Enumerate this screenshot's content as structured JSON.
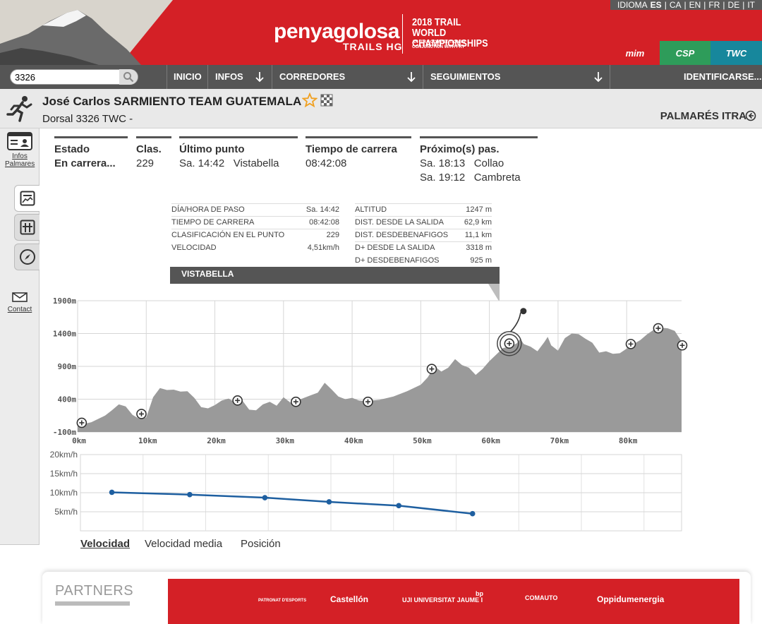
{
  "header": {
    "logo_main": "penyagolosa",
    "logo_sub": "TRAILS",
    "logo_sub_mark": "HG",
    "champ_title": "2018 TRAIL WORLD CHAMPIONSHIPS",
    "champ_sub": "AN ITRA COMPETITION IN CONJUNCTION WITH FRT",
    "language_label": "IDIOMA",
    "languages": [
      "ES",
      "CA",
      "EN",
      "FR",
      "DE",
      "IT"
    ],
    "active_language": "ES",
    "badges": [
      "mim",
      "CSP",
      "TWC"
    ]
  },
  "nav": {
    "search_value": "3326",
    "items": [
      "INICIO",
      "INFOS",
      "CORREDORES",
      "SEGUIMIENTOS",
      "IDENTIFICARSE..."
    ]
  },
  "runner": {
    "name": "José Carlos SARMIENTO",
    "team": "TEAM GUATEMALA",
    "dorsal": "Dorsal 3326   TWC -",
    "palmares": "PALMARÉS ITRA"
  },
  "sidebar": {
    "infos_label": "Infos",
    "palmares_label": "Palmares",
    "contact_label": "Contact"
  },
  "stats": {
    "estado_label": "Estado",
    "estado_value": "En carrera...",
    "clas_label": "Clas.",
    "clas_value": "229",
    "ultimo_label": "Último punto",
    "ultimo_value": "Sa. 14:42   Vistabella",
    "tiempo_label": "Tiempo de carrera",
    "tiempo_value": "08:42:08",
    "proximo_label": "Próximo(s) pas.",
    "proximo_values": [
      "Sa. 18:13   Collao",
      "Sa. 19:12   Cambreta"
    ]
  },
  "tooltip": {
    "left": [
      {
        "label": "DÍA/HORA DE PASO",
        "value": "Sa. 14:42"
      },
      {
        "label": "TIEMPO DE CARRERA",
        "value": "08:42:08"
      },
      {
        "label": "CLASIFICACIÓN EN EL PUNTO",
        "value": "229"
      },
      {
        "label": "VELOCIDAD",
        "value": "4,51km/h"
      }
    ],
    "right": [
      {
        "label": "ALTITUD",
        "value": "1247 m"
      },
      {
        "label": "DIST. DESDE LA SALIDA",
        "value": "62,9 km"
      },
      {
        "label": "DIST. DESDEBENAFIGOS",
        "value": "11,1 km"
      },
      {
        "label": "D+ DESDE LA SALIDA",
        "value": "3318 m"
      },
      {
        "label": "D+ DESDEBENAFIGOS",
        "value": "925 m"
      }
    ],
    "point_name": "VISTABELLA"
  },
  "chart_data": [
    {
      "type": "area",
      "ylim": [
        -100,
        1900
      ],
      "xlim": [
        0,
        88
      ],
      "y_ticks": [
        {
          "value": 1900,
          "label": "1900m"
        },
        {
          "value": 1400,
          "label": "1400m"
        },
        {
          "value": 900,
          "label": "900m"
        },
        {
          "value": 400,
          "label": "400m"
        },
        {
          "value": -100,
          "label": "-100m"
        }
      ],
      "x_ticks": [
        {
          "value": 0,
          "label": "0km"
        },
        {
          "value": 10,
          "label": "10km"
        },
        {
          "value": 20,
          "label": "20km"
        },
        {
          "value": 30,
          "label": "30km"
        },
        {
          "value": 40,
          "label": "40km"
        },
        {
          "value": 50,
          "label": "50km"
        },
        {
          "value": 60,
          "label": "60km"
        },
        {
          "value": 70,
          "label": "70km"
        },
        {
          "value": 80,
          "label": "80km"
        }
      ],
      "profile": [
        [
          0,
          0
        ],
        [
          2,
          50
        ],
        [
          4,
          150
        ],
        [
          5,
          230
        ],
        [
          6,
          320
        ],
        [
          7,
          290
        ],
        [
          8,
          160
        ],
        [
          9,
          100
        ],
        [
          10,
          120
        ],
        [
          11,
          430
        ],
        [
          12,
          570
        ],
        [
          13,
          540
        ],
        [
          14,
          545
        ],
        [
          15,
          515
        ],
        [
          16,
          520
        ],
        [
          17,
          420
        ],
        [
          18,
          280
        ],
        [
          19,
          260
        ],
        [
          20,
          310
        ],
        [
          21,
          380
        ],
        [
          22,
          410
        ],
        [
          23,
          350
        ],
        [
          24,
          380
        ],
        [
          25,
          240
        ],
        [
          26,
          230
        ],
        [
          27,
          320
        ],
        [
          28,
          360
        ],
        [
          29,
          300
        ],
        [
          30,
          430
        ],
        [
          31,
          350
        ],
        [
          32,
          380
        ],
        [
          33,
          420
        ],
        [
          34,
          460
        ],
        [
          35,
          500
        ],
        [
          36,
          650
        ],
        [
          37,
          550
        ],
        [
          38,
          440
        ],
        [
          39,
          400
        ],
        [
          40,
          420
        ],
        [
          41,
          380
        ],
        [
          42,
          370
        ],
        [
          44,
          390
        ],
        [
          46,
          440
        ],
        [
          48,
          520
        ],
        [
          50,
          620
        ],
        [
          51,
          730
        ],
        [
          52,
          900
        ],
        [
          53,
          820
        ],
        [
          54,
          880
        ],
        [
          55,
          1010
        ],
        [
          56,
          920
        ],
        [
          57,
          880
        ],
        [
          58,
          770
        ],
        [
          59,
          860
        ],
        [
          60,
          980
        ],
        [
          61,
          1080
        ],
        [
          62,
          1180
        ],
        [
          63,
          1200
        ],
        [
          64,
          1250
        ],
        [
          64.5,
          1320
        ],
        [
          65,
          1240
        ],
        [
          66,
          1200
        ],
        [
          67,
          1130
        ],
        [
          68,
          1270
        ],
        [
          68.5,
          1350
        ],
        [
          69,
          1220
        ],
        [
          70,
          1140
        ],
        [
          71,
          1330
        ],
        [
          72,
          1400
        ],
        [
          73,
          1390
        ],
        [
          74,
          1320
        ],
        [
          75,
          1260
        ],
        [
          76,
          1110
        ],
        [
          77,
          1130
        ],
        [
          78,
          1090
        ],
        [
          79,
          1100
        ],
        [
          80,
          1170
        ],
        [
          81,
          1240
        ],
        [
          82,
          1300
        ],
        [
          83,
          1390
        ],
        [
          84,
          1460
        ],
        [
          85,
          1490
        ],
        [
          86,
          1480
        ],
        [
          87,
          1440
        ],
        [
          88,
          1280
        ]
      ],
      "checkpoints": [
        {
          "km": 0.6,
          "alt": 40
        },
        {
          "km": 9.3,
          "alt": 175
        },
        {
          "km": 23.3,
          "alt": 380
        },
        {
          "km": 31.8,
          "alt": 360
        },
        {
          "km": 42.3,
          "alt": 360
        },
        {
          "km": 51.6,
          "alt": 860
        },
        {
          "km": 62.9,
          "alt": 1247,
          "current": true
        },
        {
          "km": 80.6,
          "alt": 1240
        },
        {
          "km": 84.6,
          "alt": 1480
        },
        {
          "km": 88.1,
          "alt": 1220
        }
      ]
    },
    {
      "type": "line",
      "ylim": [
        0,
        20
      ],
      "y_ticks": [
        {
          "value": 20,
          "label": "20km/h"
        },
        {
          "value": 15,
          "label": "15km/h"
        },
        {
          "value": 10,
          "label": "10km/h"
        },
        {
          "value": 5,
          "label": "5km/h"
        }
      ],
      "xlim": [
        0,
        88
      ],
      "series": [
        {
          "values": [
            [
              4.6,
              10.1
            ],
            [
              16,
              9.5
            ],
            [
              27,
              8.7
            ],
            [
              36.4,
              7.6
            ],
            [
              46.6,
              6.6
            ],
            [
              57.4,
              4.5
            ]
          ]
        }
      ]
    }
  ],
  "chart_tabs": [
    "Velocidad",
    "Velocidad media",
    "Posición"
  ],
  "partners": {
    "title": "PARTNERS",
    "logos": [
      "PATRONAT D'ESPORTS",
      "Castellón",
      "UJI UNIVERSITAT JAUME I",
      "bp",
      "COMAUTO",
      "Oppidumenergia"
    ]
  },
  "colors": {
    "brand_red": "#d42026",
    "nav_gray": "#555555",
    "profile_gray": "#999999",
    "speed_blue": "#1e5fa0",
    "csp_green": "#2e9c5a",
    "twc_teal": "#17879c"
  }
}
